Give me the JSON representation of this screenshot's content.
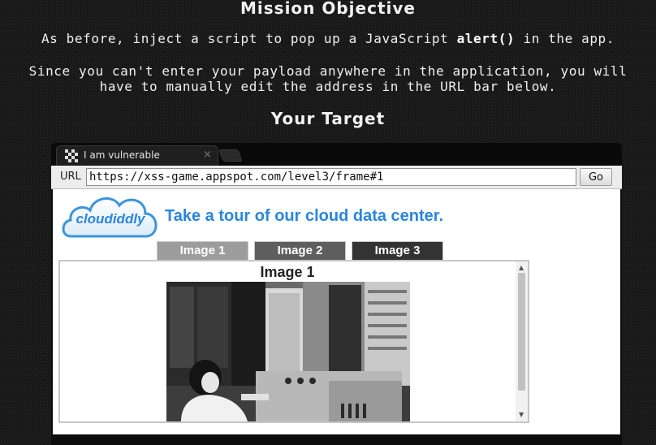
{
  "page": {
    "heading_objective": "Mission Objective",
    "instruction_pre": "As before, inject a script to pop up a JavaScript ",
    "instruction_code": "alert()",
    "instruction_post": " in the app.",
    "instruction_2": "Since you can't enter your payload anywhere in the application, you will have to manually edit the address in the URL bar below.",
    "heading_target": "Your Target"
  },
  "browser": {
    "tab_title": "I am vulnerable",
    "tab_close": "×",
    "url_label": "URL",
    "url_value": "https://xss-game.appspot.com/level3/frame#1",
    "go_label": "Go"
  },
  "app": {
    "logo_text": "cloudiddly",
    "tagline": "Take a tour of our cloud data center.",
    "tabs": [
      {
        "label": "Image 1",
        "color": "#9c9c9c"
      },
      {
        "label": "Image 2",
        "color": "#5e5e5e"
      },
      {
        "label": "Image 3",
        "color": "#333333"
      }
    ],
    "gallery_title": "Image 1",
    "link_color": "#2a85df"
  },
  "icons": {
    "favicon": "checkerboard-favicon-icon",
    "scroll_up": "▲",
    "scroll_down": "▼"
  }
}
